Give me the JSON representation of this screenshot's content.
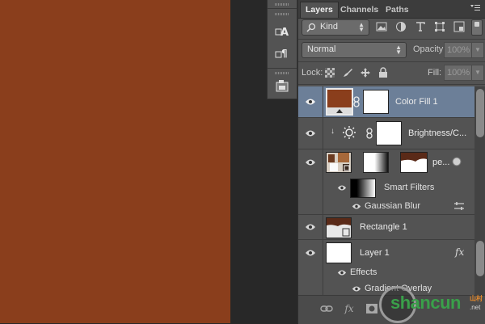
{
  "panel": {
    "tabs": [
      "Layers",
      "Channels",
      "Paths"
    ],
    "filter": {
      "kind_label": "Kind"
    },
    "blend_mode": "Normal",
    "opacity_label": "Opacity:",
    "opacity_value": "100%",
    "lock_label": "Lock:",
    "fill_label": "Fill:",
    "fill_value": "100%"
  },
  "layers": {
    "color_fill": {
      "name": "Color Fill 1",
      "swatch": "#8a3e1c"
    },
    "brightness": {
      "name": "Brightness/C..."
    },
    "smart_object": {
      "name": "pe..."
    },
    "smart_filters": "Smart Filters",
    "gaussian_blur": "Gaussian Blur",
    "rectangle": {
      "name": "Rectangle 1"
    },
    "layer1": {
      "name": "Layer 1",
      "fx": "fx"
    },
    "effects": "Effects",
    "gradient_overlay": "Gradient Overlay"
  },
  "bottom_icons": [
    "link-icon",
    "fx-icon",
    "mask-icon",
    "adjustment-icon",
    "folder-icon",
    "new-layer-icon",
    "trash-icon"
  ],
  "watermark": {
    "text": "shancun",
    "small": "山村",
    "domain": ".net"
  },
  "colors": {
    "canvas": "#8a3e1c",
    "panel": "#535353",
    "selected": "#6c7f98"
  }
}
